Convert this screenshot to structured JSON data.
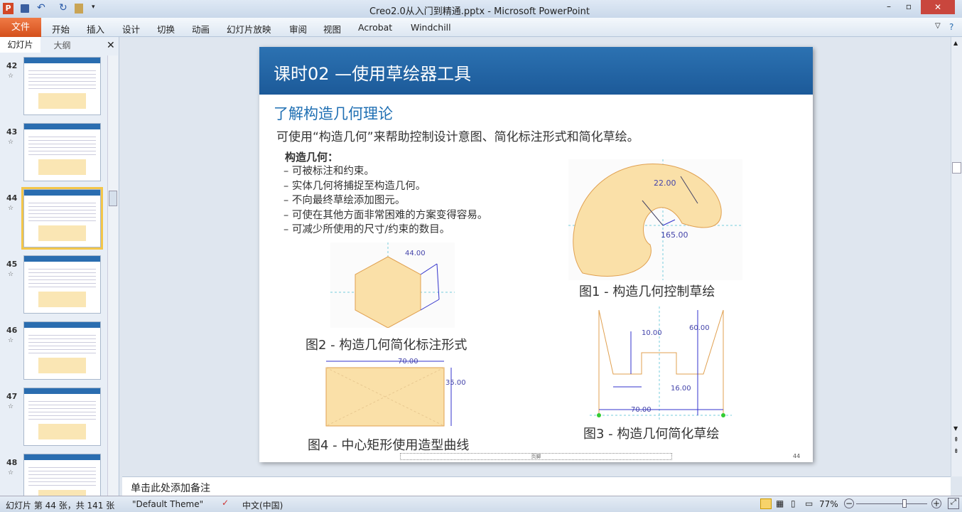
{
  "window": {
    "title": "Creo2.0从入门到精通.pptx - Microsoft PowerPoint"
  },
  "ribbon": {
    "file": "文件",
    "tabs": [
      "开始",
      "插入",
      "设计",
      "切换",
      "动画",
      "幻灯片放映",
      "审阅",
      "视图",
      "Acrobat",
      "Windchill"
    ]
  },
  "panel": {
    "tabs": [
      "幻灯片",
      "大纲"
    ],
    "close": "✕",
    "thumbnails": [
      {
        "num": "42"
      },
      {
        "num": "43"
      },
      {
        "num": "44",
        "selected": true
      },
      {
        "num": "45"
      },
      {
        "num": "46"
      },
      {
        "num": "47"
      },
      {
        "num": "48"
      }
    ]
  },
  "slide": {
    "title": "课时02 —使用草绘器工具",
    "heading": "了解构造几何理论",
    "subtitle": "可使用“构造几何”来帮助控制设计意图、简化标注形式和简化草绘。",
    "list_title": "构造几何：",
    "bullets": [
      "– 可被标注和约束。",
      "– 实体几何将捕捉至构造几何。",
      "– 不向最终草绘添加图元。",
      "– 可使在其他方面非常困难的方案变得容易。",
      "– 可减少所使用的尺寸/约束的数目。"
    ],
    "fig1": {
      "caption": "图1 - 构造几何控制草绘",
      "dims": [
        "22.00",
        "165.00"
      ]
    },
    "fig2": {
      "caption": "图2 - 构造几何简化标注形式",
      "dims": [
        "44.00"
      ]
    },
    "fig3": {
      "caption": "图3 - 构造几何简化草绘",
      "dims": [
        "10.00",
        "60.00",
        "16.00",
        "70.00"
      ]
    },
    "fig4": {
      "caption": "图4 - 中心矩形使用造型曲线",
      "dims": [
        "70.00",
        "35.00"
      ]
    },
    "page_number": "44",
    "footer": "页脚"
  },
  "notes": {
    "placeholder": "单击此处添加备注"
  },
  "status": {
    "slide_info": "幻灯片 第 44 张，共 141 张",
    "theme": "\"Default Theme\"",
    "language": "中文(中国)",
    "zoom": "77%",
    "zoom_level_percent": 77
  }
}
